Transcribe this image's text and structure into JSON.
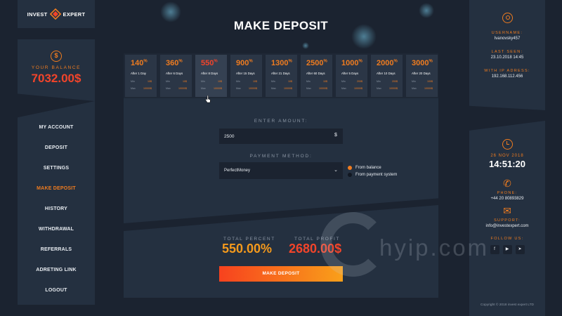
{
  "brand": {
    "left": "INVEST",
    "right": "EXPERT"
  },
  "balance": {
    "label": "YOUR BALANCE",
    "value": "7032.00$"
  },
  "menu": [
    {
      "label": "MY ACCOUNT",
      "active": false
    },
    {
      "label": "DEPOSIT",
      "active": false
    },
    {
      "label": "SETTINGS",
      "active": false
    },
    {
      "label": "MAKE DEPOSIT",
      "active": true
    },
    {
      "label": "HISTORY",
      "active": false
    },
    {
      "label": "WITHDRAWAL",
      "active": false
    },
    {
      "label": "REFERRALS",
      "active": false
    },
    {
      "label": "ADRETING LINK",
      "active": false
    },
    {
      "label": "LOGOUT",
      "active": false
    }
  ],
  "page_title": "MAKE DEPOSIT",
  "plans": [
    {
      "percent": "140",
      "days": "After 1 Day",
      "min_label": "Min",
      "min": "10$",
      "max_label": "Max",
      "max": "10000$",
      "selected": false
    },
    {
      "percent": "360",
      "days": "After 6 Days",
      "min_label": "Min",
      "min": "10$",
      "max_label": "Max",
      "max": "10000$",
      "selected": false
    },
    {
      "percent": "550",
      "days": "After 8 Days",
      "min_label": "Min",
      "min": "10$",
      "max_label": "Max",
      "max": "10000$",
      "selected": true
    },
    {
      "percent": "900",
      "days": "After 15 Days",
      "min_label": "Min",
      "min": "10$",
      "max_label": "Max",
      "max": "10000$",
      "selected": false
    },
    {
      "percent": "1300",
      "days": "After 21 Days",
      "min_label": "Min",
      "min": "10$",
      "max_label": "Max",
      "max": "10000$",
      "selected": false
    },
    {
      "percent": "2500",
      "days": "After 60 Days",
      "min_label": "Min",
      "min": "10$",
      "max_label": "Max",
      "max": "10000$",
      "selected": false
    },
    {
      "percent": "1000",
      "days": "After 5 Days",
      "min_label": "Min",
      "min": "200$",
      "max_label": "Max",
      "max": "10000$",
      "selected": false
    },
    {
      "percent": "2000",
      "days": "After 10 Days",
      "min_label": "Min",
      "min": "200$",
      "max_label": "Max",
      "max": "10000$",
      "selected": false
    },
    {
      "percent": "3000",
      "days": "After 20 Days",
      "min_label": "Min",
      "min": "100$",
      "max_label": "Max",
      "max": "10000$",
      "selected": false
    }
  ],
  "percent_suffix": "%",
  "form": {
    "amount_label": "ENTER AMOUNT:",
    "amount_value": "2500",
    "currency": "$",
    "method_label": "PAYMENT METHOD:",
    "method_value": "PerfectMoney",
    "radio_balance": "From balance",
    "radio_system": "From payment system"
  },
  "totals": {
    "percent_label": "TOTAL PERCENT",
    "percent_value": "550.00%",
    "profit_label": "TOTAL PROFIT",
    "profit_value": "2680.00$"
  },
  "submit_label": "MAKE DEPOSIT",
  "user": {
    "username_label": "USERNAME:",
    "username": "Ivanovsky457",
    "last_seen_label": "LAST SEEN:",
    "last_seen": "23.10.2018  14:45",
    "ip_label": "WITH IP ADRESS:",
    "ip": "192.168.112.456"
  },
  "clock": {
    "date": "26 NOV 2018",
    "time": "14:51:20"
  },
  "contact": {
    "phone_label": "PHONE:",
    "phone": "+44 20 80893829",
    "support_label": "SUPPORT:",
    "support": "info@investexpert.com",
    "follow_label": "FOLLOW US:"
  },
  "social": [
    "f",
    "▶",
    "➤"
  ],
  "copyright": "Copyright © 2018 invest expert LTD",
  "watermark": "hyip.com",
  "colors": {
    "accent": "#f07c1f",
    "red": "#f2442a",
    "bg": "#1b2330",
    "panel": "#243040"
  }
}
